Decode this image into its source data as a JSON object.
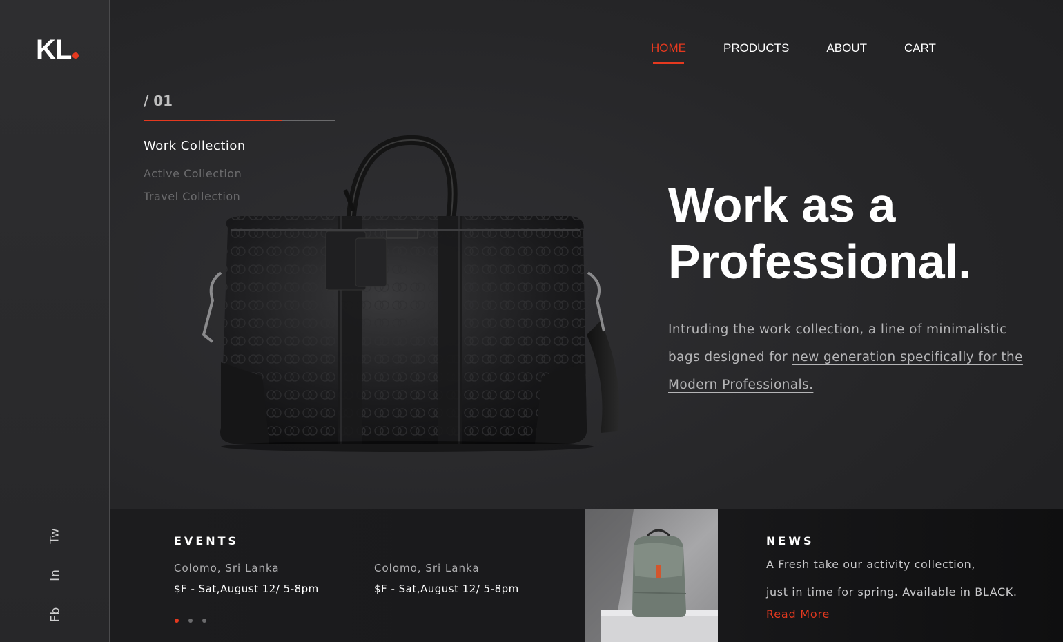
{
  "brand": {
    "logo_text": "KL",
    "accent": "#e5391f"
  },
  "nav": {
    "items": [
      {
        "label": "HOME",
        "active": true
      },
      {
        "label": "PRODUCTS",
        "active": false
      },
      {
        "label": "ABOUT",
        "active": false
      },
      {
        "label": "CART",
        "active": false
      }
    ]
  },
  "social": {
    "twitter": "Tw",
    "linkedin": "In",
    "facebook": "Fb"
  },
  "slider": {
    "number": "/ 01",
    "collections": [
      "Work Collection",
      "Active Collection",
      "Travel Collection"
    ]
  },
  "hero": {
    "headline_line1": "Work as a",
    "headline_line2": "Professional.",
    "desc_plain": "Intruding the work collection, a line of minimalistic bags designed for ",
    "desc_link": "new generation specifically for the Modern Professionals."
  },
  "events": {
    "title": "EVENTS",
    "items": [
      {
        "location": "Colomo, Sri Lanka",
        "when": "$F - Sat,August 12/ 5-8pm"
      },
      {
        "location": "Colomo, Sri Lanka",
        "when": "$F - Sat,August 12/ 5-8pm"
      }
    ]
  },
  "news": {
    "title": "NEWS",
    "line1": "A Fresh take our activity collection,",
    "line2": "just in time for spring. Available in BLACK.",
    "read_more": "Read More"
  },
  "icons": {
    "logo_dot": "red-dot",
    "bag": "duffel-bag-image",
    "news_image": "backpack-image"
  }
}
